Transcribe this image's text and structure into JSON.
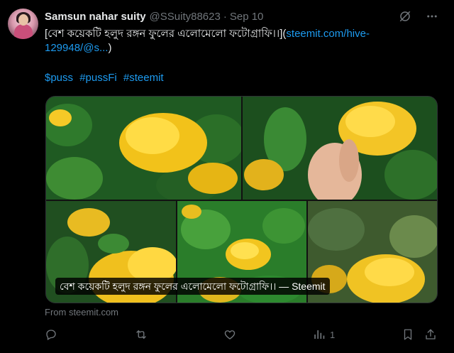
{
  "author": {
    "name": "Samsun nahar suity",
    "handle": "@SSuity88623",
    "separator": "·",
    "date": "Sep 10"
  },
  "post": {
    "text_before_link": "[বেশ কয়েকটি হলুদ রঙ্গন ফুলের এলোমেলো ফটোগ্রাফি।।](",
    "link": "steemit.com/hive-129948/@s...",
    "text_after_link": ")",
    "hashtags": [
      "$puss",
      "#pussFi",
      "#steemit"
    ]
  },
  "media": {
    "caption": "বেশ কয়েকটি হলুদ রঙ্গন ফুলের এলোমেলো ফটোগ্রাফি।। — Steemit",
    "source": "From steemit.com"
  },
  "actions": {
    "reply_icon": "reply-icon",
    "repost_icon": "repost-icon",
    "like_icon": "heart-icon",
    "views_icon": "views-icon",
    "views_count": "1",
    "bookmark_icon": "bookmark-icon",
    "share_icon": "share-icon"
  },
  "colors": {
    "background": "#000000",
    "text": "#e7e9ea",
    "muted": "#71767b",
    "link": "#1d9bf0"
  }
}
